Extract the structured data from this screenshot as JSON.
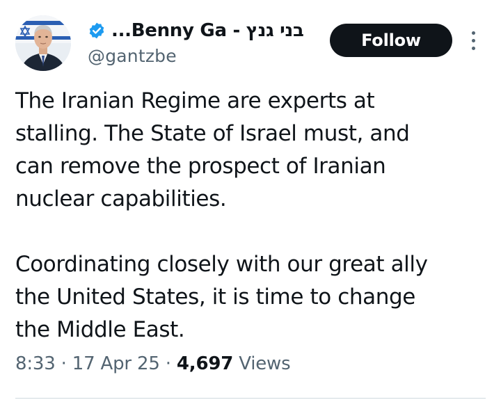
{
  "author": {
    "display_name": "בני גנץ - Benny Ga...",
    "handle": "@gantzbe",
    "verified_color": "#1d9bf0",
    "avatar_icon": "profile-photo"
  },
  "actions": {
    "follow_label": "Follow",
    "more_icon": "vertical-ellipsis"
  },
  "tweet": {
    "paragraphs": [
      {
        "lines": [
          "The Iranian Regime are experts at",
          "stalling. The State of Israel must, and",
          "can remove the prospect of Iranian",
          "nuclear capabilities."
        ]
      },
      {
        "lines": [
          "Coordinating closely with our great ally",
          "the United States, it is time to change",
          "the Middle East."
        ]
      }
    ]
  },
  "meta": {
    "time": "8:33",
    "sep1": " · ",
    "date": "17 Apr 25",
    "sep2": " · ",
    "views_count": "4,697",
    "views_label": " Views"
  },
  "colors": {
    "text_primary": "#0f1419",
    "text_secondary": "#536471",
    "follow_bg": "#0f1419",
    "divider": "#cfd9de"
  }
}
